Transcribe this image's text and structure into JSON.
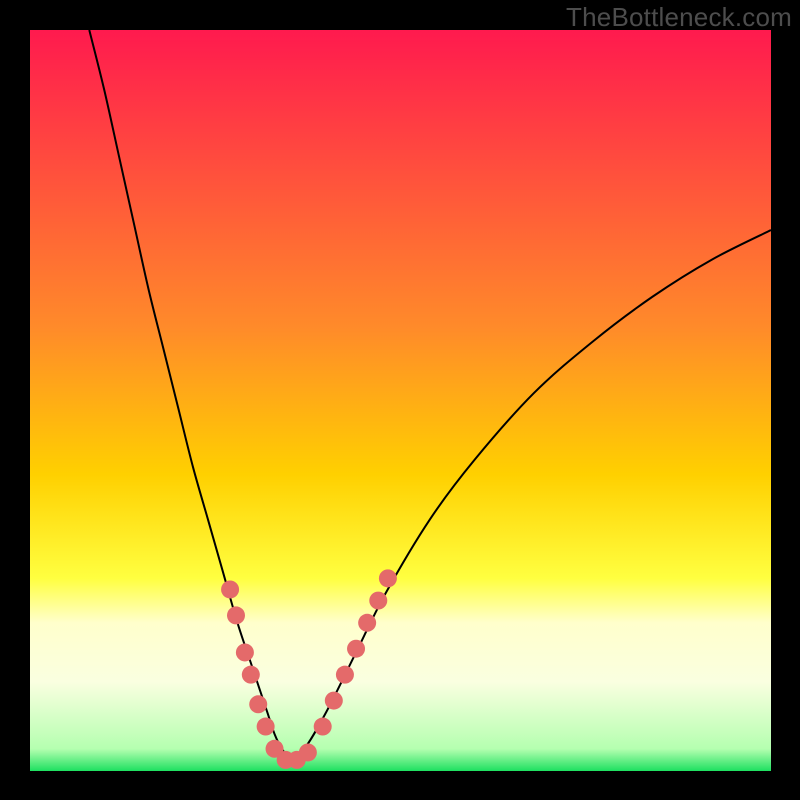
{
  "watermark": "TheBottleneck.com",
  "chart_data": {
    "type": "line",
    "title": "",
    "xlabel": "",
    "ylabel": "",
    "xlim": [
      0,
      100
    ],
    "ylim": [
      0,
      100
    ],
    "grid": false,
    "legend": false,
    "gradient_stops": [
      {
        "offset": 0.0,
        "color": "#ff1a4e"
      },
      {
        "offset": 0.4,
        "color": "#ff8a2a"
      },
      {
        "offset": 0.6,
        "color": "#ffd000"
      },
      {
        "offset": 0.74,
        "color": "#ffff40"
      },
      {
        "offset": 0.8,
        "color": "#ffffcc"
      },
      {
        "offset": 0.88,
        "color": "#faffe0"
      },
      {
        "offset": 0.97,
        "color": "#b5ffb0"
      },
      {
        "offset": 1.0,
        "color": "#1de060"
      }
    ],
    "series": [
      {
        "name": "bottleneck-curve",
        "stroke": "#000000",
        "width": 2,
        "x": [
          8,
          10,
          12,
          14,
          16,
          18,
          20,
          22,
          24,
          26,
          28,
          30,
          32,
          33,
          34,
          35,
          37,
          40,
          44,
          48,
          54,
          60,
          68,
          76,
          84,
          92,
          100
        ],
        "y": [
          100,
          92,
          83,
          74,
          65,
          57,
          49,
          41,
          34,
          27,
          20,
          14,
          8,
          5,
          3,
          2,
          3,
          8,
          16,
          24,
          34,
          42,
          51,
          58,
          64,
          69,
          73
        ]
      }
    ],
    "scatter_points": {
      "name": "highlight-dots",
      "fill": "#e46a6a",
      "radius": 9,
      "points": [
        {
          "x": 27.0,
          "y": 24.5
        },
        {
          "x": 27.8,
          "y": 21.0
        },
        {
          "x": 29.0,
          "y": 16.0
        },
        {
          "x": 29.8,
          "y": 13.0
        },
        {
          "x": 30.8,
          "y": 9.0
        },
        {
          "x": 31.8,
          "y": 6.0
        },
        {
          "x": 33.0,
          "y": 3.0
        },
        {
          "x": 34.5,
          "y": 1.5
        },
        {
          "x": 36.0,
          "y": 1.5
        },
        {
          "x": 37.5,
          "y": 2.5
        },
        {
          "x": 39.5,
          "y": 6.0
        },
        {
          "x": 41.0,
          "y": 9.5
        },
        {
          "x": 42.5,
          "y": 13.0
        },
        {
          "x": 44.0,
          "y": 16.5
        },
        {
          "x": 45.5,
          "y": 20.0
        },
        {
          "x": 47.0,
          "y": 23.0
        },
        {
          "x": 48.3,
          "y": 26.0
        }
      ]
    }
  }
}
